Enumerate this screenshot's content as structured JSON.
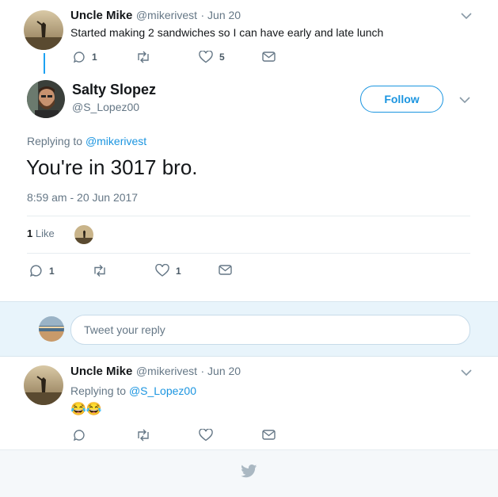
{
  "tweet1": {
    "name": "Uncle Mike",
    "handle": "@mikerivest",
    "sep_date": "· Jun 20",
    "text": "Started making 2 sandwiches so I can have early and late lunch",
    "reply_count": "1",
    "like_count": "5"
  },
  "main": {
    "name": "Salty Slopez",
    "handle": "@S_Lopez00",
    "follow_label": "Follow",
    "replying_prefix": "Replying to",
    "replying_to": "@mikerivest",
    "text": "You're in 3017 bro.",
    "timestamp": "8:59 am - 20 Jun 2017",
    "likes_count": "1",
    "likes_label": "Like",
    "reply_count": "1",
    "like_count": "1"
  },
  "composer": {
    "placeholder": "Tweet your reply"
  },
  "tweet2": {
    "name": "Uncle Mike",
    "handle": "@mikerivest",
    "sep_date": "· Jun 20",
    "replying_prefix": "Replying to",
    "replying_to": "@S_Lopez00",
    "emoji": "😂😂"
  },
  "colors": {
    "accent": "#1b95e0",
    "muted": "#657786",
    "composer_bg": "#e8f4fb",
    "footer_bg": "#f5f8fa"
  },
  "icons": [
    "chevron-down-icon",
    "reply-icon",
    "retweet-icon",
    "heart-icon",
    "message-icon",
    "twitter-bird-icon"
  ]
}
